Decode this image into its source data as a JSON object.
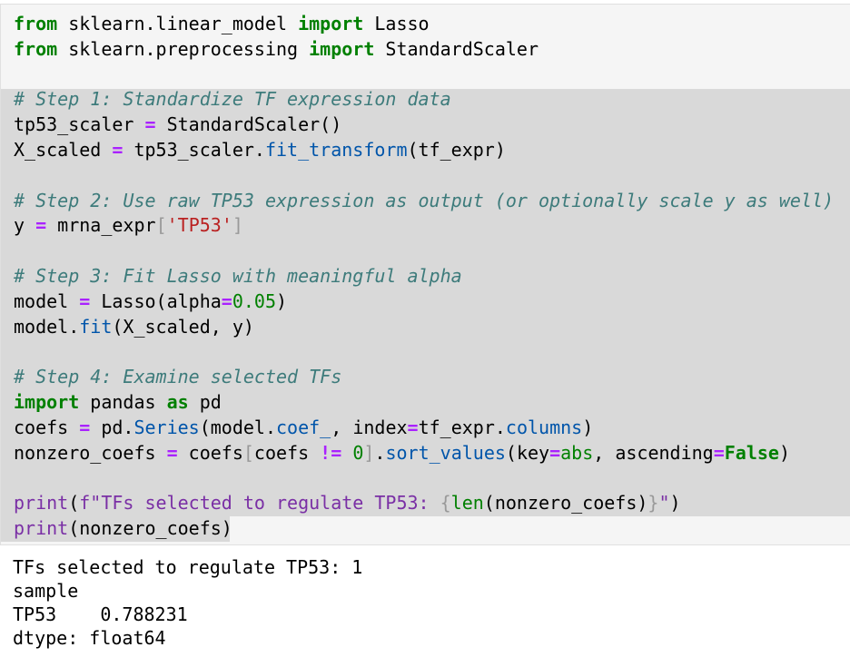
{
  "cell": {
    "lines": [
      {
        "parts": [
          [
            "kw",
            "from"
          ],
          [
            "t",
            " sklearn.linear_model "
          ],
          [
            "kw",
            "import"
          ],
          [
            "t",
            " Lasso"
          ]
        ]
      },
      {
        "parts": [
          [
            "kw",
            "from"
          ],
          [
            "t",
            " sklearn.preprocessing "
          ],
          [
            "kw",
            "import"
          ],
          [
            "t",
            " StandardScaler"
          ]
        ]
      },
      {
        "parts": []
      },
      {
        "parts": [
          [
            "cm",
            "# Step 1: Standardize TF expression data"
          ]
        ]
      },
      {
        "parts": [
          [
            "t",
            "tp53_scaler "
          ],
          [
            "op",
            "="
          ],
          [
            "t",
            " StandardScaler()"
          ]
        ]
      },
      {
        "parts": [
          [
            "t",
            "X_scaled "
          ],
          [
            "op",
            "="
          ],
          [
            "t",
            " tp53_scaler."
          ],
          [
            "fn",
            "fit_transform"
          ],
          [
            "t",
            "(tf_expr)"
          ]
        ]
      },
      {
        "parts": []
      },
      {
        "parts": [
          [
            "cm",
            "# Step 2: Use raw TP53 expression as output (or optionally scale y as well)"
          ]
        ]
      },
      {
        "parts": [
          [
            "t",
            "y "
          ],
          [
            "op",
            "="
          ],
          [
            "t",
            " mrna_expr"
          ],
          [
            "br",
            "["
          ],
          [
            "str",
            "'TP53'"
          ],
          [
            "br",
            "]"
          ]
        ]
      },
      {
        "parts": []
      },
      {
        "parts": [
          [
            "cm",
            "# Step 3: Fit Lasso with meaningful alpha"
          ]
        ]
      },
      {
        "parts": [
          [
            "t",
            "model "
          ],
          [
            "op",
            "="
          ],
          [
            "t",
            " Lasso(alpha"
          ],
          [
            "op",
            "="
          ],
          [
            "num",
            "0.05"
          ],
          [
            "t",
            ")"
          ]
        ]
      },
      {
        "parts": [
          [
            "t",
            "model."
          ],
          [
            "fn",
            "fit"
          ],
          [
            "t",
            "(X_scaled, y)"
          ]
        ]
      },
      {
        "parts": []
      },
      {
        "parts": [
          [
            "cm",
            "# Step 4: Examine selected TFs"
          ]
        ]
      },
      {
        "parts": [
          [
            "kw",
            "import"
          ],
          [
            "t",
            " pandas "
          ],
          [
            "kw",
            "as"
          ],
          [
            "t",
            " pd"
          ]
        ]
      },
      {
        "parts": [
          [
            "t",
            "coefs "
          ],
          [
            "op",
            "="
          ],
          [
            "t",
            " pd."
          ],
          [
            "fn",
            "Series"
          ],
          [
            "t",
            "(model."
          ],
          [
            "fn",
            "coef_"
          ],
          [
            "t",
            ", index"
          ],
          [
            "op",
            "="
          ],
          [
            "t",
            "tf_expr."
          ],
          [
            "fn",
            "columns"
          ],
          [
            "t",
            ")"
          ]
        ]
      },
      {
        "parts": [
          [
            "t",
            "nonzero_coefs "
          ],
          [
            "op",
            "="
          ],
          [
            "t",
            " coefs"
          ],
          [
            "br",
            "["
          ],
          [
            "t",
            "coefs "
          ],
          [
            "op",
            "!="
          ],
          [
            "t",
            " "
          ],
          [
            "num",
            "0"
          ],
          [
            "br",
            "]"
          ],
          [
            "t",
            "."
          ],
          [
            "fn",
            "sort_values"
          ],
          [
            "t",
            "(key"
          ],
          [
            "op",
            "="
          ],
          [
            "bi",
            "abs"
          ],
          [
            "t",
            ", ascending"
          ],
          [
            "op",
            "="
          ],
          [
            "kw",
            "False"
          ],
          [
            "t",
            ")"
          ]
        ]
      },
      {
        "parts": []
      },
      {
        "parts": [
          [
            "pf",
            "print"
          ],
          [
            "t",
            "("
          ],
          [
            "pf",
            "f\"TFs selected to regulate TP53: "
          ],
          [
            "br",
            "{"
          ],
          [
            "bi",
            "len"
          ],
          [
            "t",
            "(nonzero_coefs)"
          ],
          [
            "br",
            "}"
          ],
          [
            "pf",
            "\""
          ],
          [
            "t",
            ")"
          ]
        ]
      },
      {
        "parts": [
          [
            "pf",
            "print"
          ],
          [
            "t",
            "(nonzero_coefs)"
          ]
        ]
      }
    ]
  },
  "output": {
    "lines": [
      "TFs selected to regulate TP53: 1",
      "sample",
      "TP53    0.788231",
      "dtype: float64"
    ]
  }
}
